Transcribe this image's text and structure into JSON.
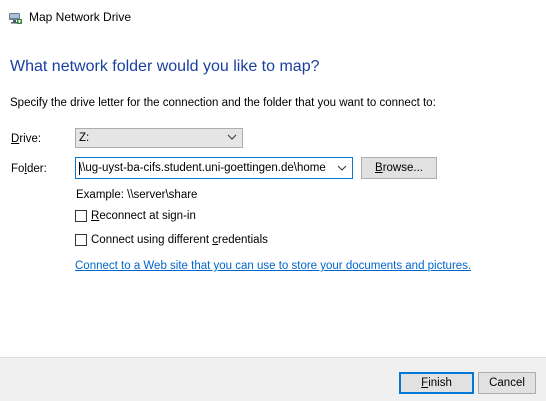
{
  "window": {
    "title": "Map Network Drive",
    "icon": "network-drive-icon"
  },
  "main": {
    "heading": "What network folder would you like to map?",
    "instructions": "Specify the drive letter for the connection and the folder that you want to connect to:",
    "drive": {
      "label_accel": "D",
      "label_rest": "rive:",
      "value": "Z:"
    },
    "folder": {
      "label_pre": "Fo",
      "label_accel": "l",
      "label_rest": "der:",
      "value": "\\\\ug-uyst-ba-cifs.student.uni-goettingen.de\\home"
    },
    "browse": {
      "accel": "B",
      "rest": "rowse..."
    },
    "example": "Example: \\\\server\\share",
    "reconnect": {
      "accel": "R",
      "rest": "econnect at sign-in",
      "checked": false
    },
    "credentials": {
      "pre": "Connect using different ",
      "accel": "c",
      "rest": "redentials",
      "checked": false
    },
    "link": "Connect to a Web site that you can use to store your documents and pictures."
  },
  "footer": {
    "finish": {
      "accel": "F",
      "rest": "inish"
    },
    "cancel": "Cancel"
  },
  "colors": {
    "heading": "#1a3fa0",
    "link": "#0066cc",
    "focus": "#0078d7"
  }
}
